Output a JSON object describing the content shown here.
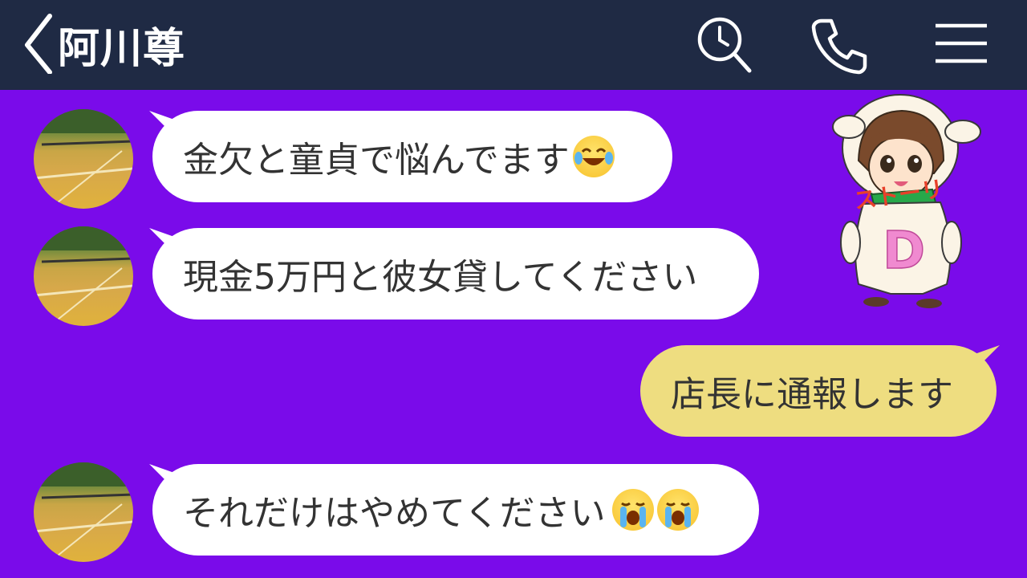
{
  "header": {
    "back_icon": "chevron-left-icon",
    "title": "阿川尊",
    "icons": [
      "search-clock-icon",
      "phone-icon",
      "menu-icon"
    ]
  },
  "messages": [
    {
      "side": "incoming",
      "text": "金欠と童貞で悩んでます",
      "emoji": [
        "laughing-tears-emoji"
      ]
    },
    {
      "side": "incoming",
      "text": "現金5万円と彼女貸してください",
      "emoji": []
    },
    {
      "side": "outgoing",
      "text": "店長に通報します",
      "emoji": []
    },
    {
      "side": "incoming",
      "text": "それだけはやめてください",
      "emoji": [
        "crying-emoji",
        "crying-emoji"
      ]
    }
  ],
  "sticker": {
    "icon": "sheep-costume-girl-sticker",
    "text_top": "ストーリ",
    "text_bottom": "D"
  },
  "colors": {
    "background": "#7a0bea",
    "header": "#1f2a44",
    "incoming_bubble": "#ffffff",
    "outgoing_bubble": "#eedd80"
  }
}
